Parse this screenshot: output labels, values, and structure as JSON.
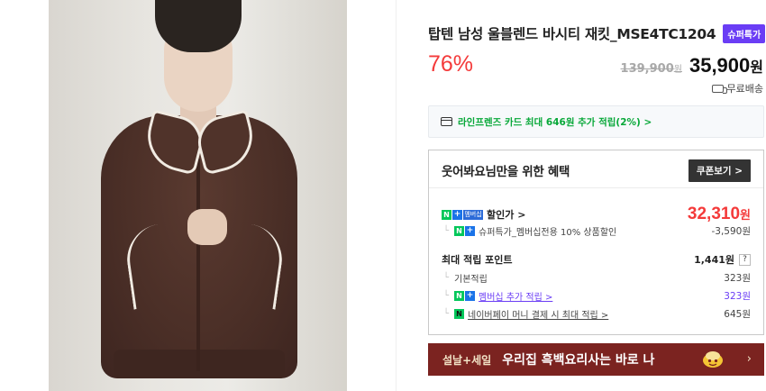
{
  "product": {
    "title": "탑텐 남성 울블렌드 바시티 재킷_MSE4TC1204",
    "badge": "슈퍼특가",
    "discount": "76%",
    "original_price": "139,900",
    "original_unit": "원",
    "sale_price": "35,900",
    "sale_unit": "원",
    "shipping": "무료배송"
  },
  "card_promo": "라인프렌즈 카드 최대 646원 추가 적립(2%) >",
  "benefit": {
    "heading": "웃어봐요님만을 위한 혜택",
    "coupon_button": "쿠폰보기 >",
    "discount_label": "할인가 >",
    "discount_value": "32,310",
    "discount_unit": "원",
    "membership_badge": "멤버십",
    "super_discount_label": "슈퍼특가_멤버십전용 10% 상품할인",
    "super_discount_value": "-3,590원",
    "points_label": "최대 적립 포인트",
    "points_value": "1,441원",
    "points_help": "?",
    "basic_label": "기본적립",
    "basic_value": "323원",
    "membership_label": "멤버십 추가 적립 >",
    "membership_value": "323원",
    "npay_label": "네이버페이 머니 결제 시 최대 적립 >",
    "npay_value": "645원"
  },
  "banner": {
    "tag": "설날+세일",
    "text": "우리집 흑백요리사는 바로 나",
    "chevron": "›"
  },
  "colors": {
    "discount_red": "#f43a3a",
    "badge_purple": "#6a3df5",
    "naver_green": "#03c75a",
    "banner_bg": "#7b2320"
  }
}
